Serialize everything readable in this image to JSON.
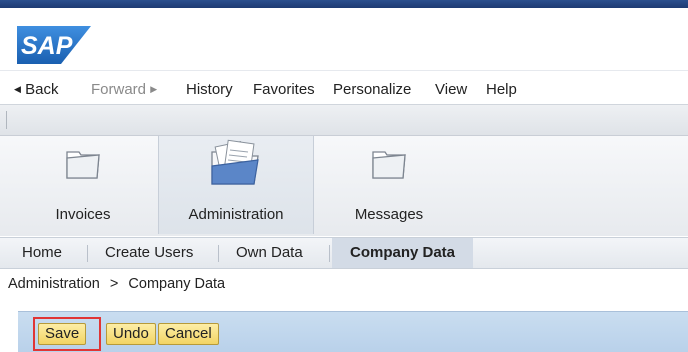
{
  "logo": {
    "text": "SAP",
    "color": "#1a63b8"
  },
  "menu": {
    "back": "Back",
    "forward": "Forward",
    "items": [
      "History",
      "Favorites",
      "Personalize",
      "View",
      "Help"
    ]
  },
  "tabs": [
    {
      "label": "Invoices",
      "icon": "folder-icon",
      "active": false
    },
    {
      "label": "Administration",
      "icon": "documents-icon",
      "active": true
    },
    {
      "label": "Messages",
      "icon": "folder-icon",
      "active": false
    }
  ],
  "subnav": [
    {
      "label": "Home",
      "active": false
    },
    {
      "label": "Create Users",
      "active": false
    },
    {
      "label": "Own Data",
      "active": false
    },
    {
      "label": "Company Data",
      "active": true
    }
  ],
  "breadcrumb": {
    "parent": "Administration",
    "separator": ">",
    "current": "Company Data"
  },
  "actions": {
    "save": "Save",
    "undo": "Undo",
    "cancel": "Cancel"
  },
  "colors": {
    "accent_blue": "#1d3a72",
    "button_yellow": "#f2d464",
    "highlight_red": "#e03535"
  }
}
